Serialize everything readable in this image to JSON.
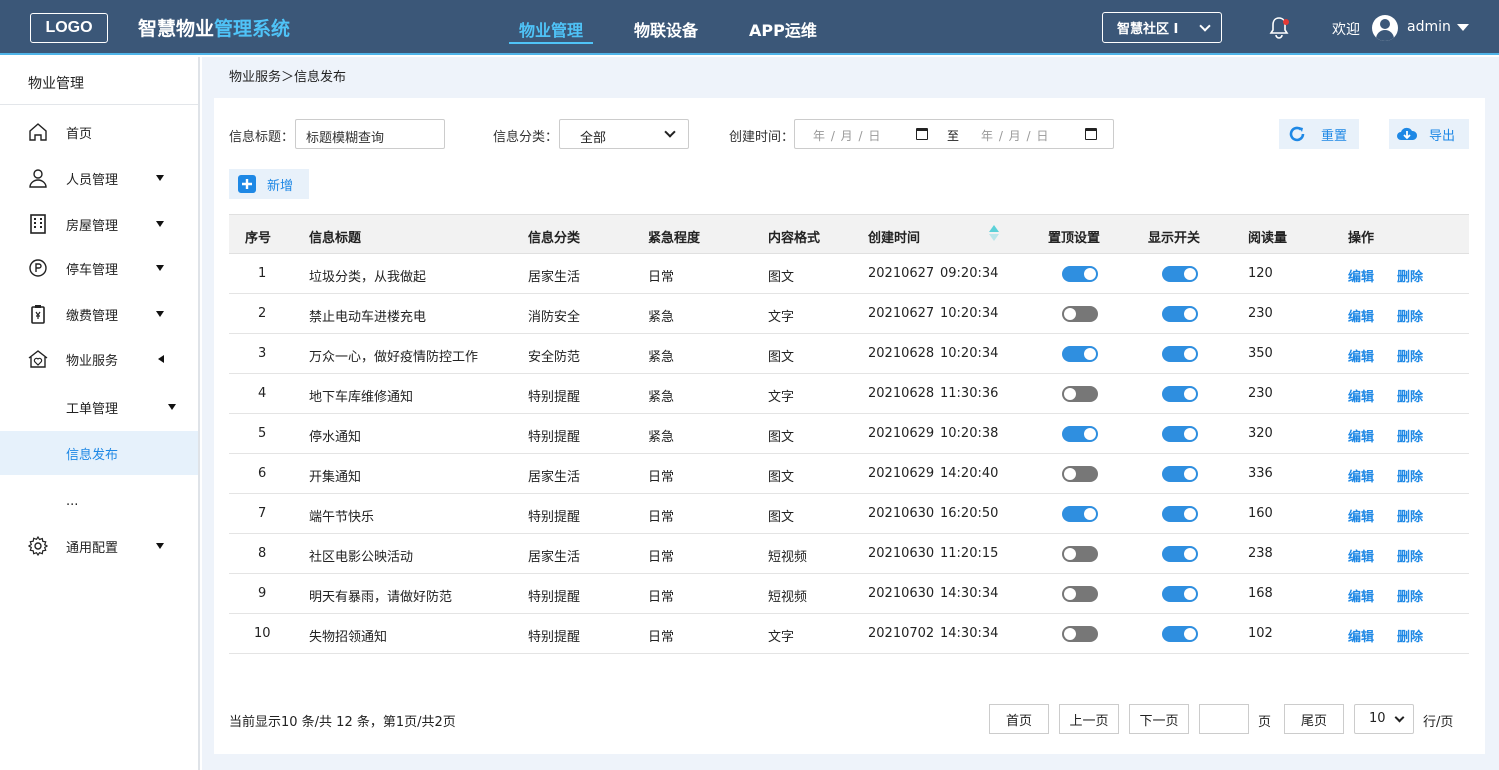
{
  "header": {
    "logo": "LOGO",
    "title_part1": "智慧物业",
    "title_part2": "管理系统",
    "nav": [
      {
        "label": "物业管理",
        "active": true
      },
      {
        "label": "物联设备",
        "active": false
      },
      {
        "label": "APP运维",
        "active": false
      }
    ],
    "community": "智慧社区 I",
    "welcome": "欢迎",
    "user": "admin",
    "accent_color": "#4fc3f7",
    "bar_color": "#3b5778"
  },
  "sidebar": {
    "title": "物业管理",
    "items": [
      {
        "label": "首页",
        "icon": "home-icon"
      },
      {
        "label": "人员管理",
        "icon": "user-icon"
      },
      {
        "label": "房屋管理",
        "icon": "building-icon"
      },
      {
        "label": "停车管理",
        "icon": "parking-icon"
      },
      {
        "label": "缴费管理",
        "icon": "payment-icon"
      },
      {
        "label": "物业服务",
        "icon": "house-service-icon"
      },
      {
        "label": "工单管理",
        "icon": ""
      },
      {
        "label": "信息发布",
        "icon": "",
        "active": true
      },
      {
        "label": "...",
        "icon": ""
      },
      {
        "label": "通用配置",
        "icon": "gear-icon"
      }
    ]
  },
  "breadcrumb": "物业服务＞信息发布",
  "filters": {
    "title_label": "信息标题：",
    "title_value": "标题模糊查询",
    "category_label": "信息分类：",
    "category_value": "全部",
    "date_label": "创建时间：",
    "date_placeholder": "年 / 月 / 日",
    "date_to": "至",
    "reset": "重置",
    "export": "导出",
    "add": "新增"
  },
  "table": {
    "headers": [
      "序号",
      "信息标题",
      "信息分类",
      "紧急程度",
      "内容格式",
      "创建时间",
      "置顶设置",
      "显示开关",
      "阅读量",
      "操作"
    ],
    "edit": "编辑",
    "delete": "删除",
    "rows": [
      {
        "no": "1",
        "title": "垃圾分类，从我做起",
        "category": "居家生活",
        "urgency": "日常",
        "format": "图文",
        "date": "20210627",
        "time": "09:20:34",
        "pinned": true,
        "visible": true,
        "reads": "120"
      },
      {
        "no": "2",
        "title": "禁止电动车进楼充电",
        "category": "消防安全",
        "urgency": "紧急",
        "format": "文字",
        "date": "20210627",
        "time": "10:20:34",
        "pinned": false,
        "visible": true,
        "reads": "230"
      },
      {
        "no": "3",
        "title": "万众一心，做好疫情防控工作",
        "category": "安全防范",
        "urgency": "紧急",
        "format": "图文",
        "date": "20210628",
        "time": "10:20:34",
        "pinned": true,
        "visible": true,
        "reads": "350"
      },
      {
        "no": "4",
        "title": "地下车库维修通知",
        "category": "特别提醒",
        "urgency": "紧急",
        "format": "文字",
        "date": "20210628",
        "time": "11:30:36",
        "pinned": false,
        "visible": true,
        "reads": "230"
      },
      {
        "no": "5",
        "title": "停水通知",
        "category": "特别提醒",
        "urgency": "紧急",
        "format": "图文",
        "date": "20210629",
        "time": "10:20:38",
        "pinned": true,
        "visible": true,
        "reads": "320"
      },
      {
        "no": "6",
        "title": "开集通知",
        "category": "居家生活",
        "urgency": "日常",
        "format": "图文",
        "date": "20210629",
        "time": "14:20:40",
        "pinned": false,
        "visible": true,
        "reads": "336"
      },
      {
        "no": "7",
        "title": "端午节快乐",
        "category": "特别提醒",
        "urgency": "日常",
        "format": "图文",
        "date": "20210630",
        "time": "16:20:50",
        "pinned": true,
        "visible": true,
        "reads": "160"
      },
      {
        "no": "8",
        "title": "社区电影公映活动",
        "category": "居家生活",
        "urgency": "日常",
        "format": "短视频",
        "date": "20210630",
        "time": "11:20:15",
        "pinned": false,
        "visible": true,
        "reads": "238"
      },
      {
        "no": "9",
        "title": "明天有暴雨，请做好防范",
        "category": "特别提醒",
        "urgency": "日常",
        "format": "短视频",
        "date": "20210630",
        "time": "14:30:34",
        "pinned": false,
        "visible": true,
        "reads": "168"
      },
      {
        "no": "10",
        "title": "失物招领通知",
        "category": "特别提醒",
        "urgency": "日常",
        "format": "文字",
        "date": "20210702",
        "time": "14:30:34",
        "pinned": false,
        "visible": true,
        "reads": "102"
      }
    ]
  },
  "pagination": {
    "info": "当前显示10 条/共 12 条，第1页/共2页",
    "first": "首页",
    "prev": "上一页",
    "next": "下一页",
    "page_unit": "页",
    "last": "尾页",
    "page_size": "10",
    "per_page_unit": "行/页"
  }
}
